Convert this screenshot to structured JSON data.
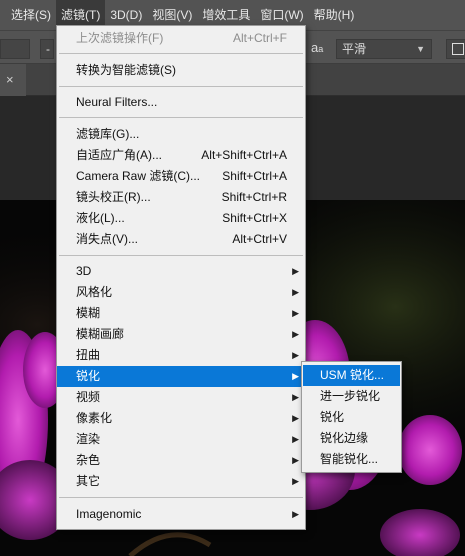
{
  "menubar": {
    "items": [
      {
        "label": "选择(S)"
      },
      {
        "label": "滤镜(T)"
      },
      {
        "label": "3D(D)"
      },
      {
        "label": "视图(V)"
      },
      {
        "label": "增效工具"
      },
      {
        "label": "窗口(W)"
      },
      {
        "label": "帮助(H)"
      }
    ]
  },
  "optbar": {
    "left_field": "",
    "left_dash": "-",
    "aa_big": "a",
    "aa_small": "a",
    "smooth_value": "平滑"
  },
  "tabs": {
    "close_glyph": "×"
  },
  "filter_menu": {
    "last_filter": {
      "label": "上次滤镜操作(F)",
      "shortcut": "Alt+Ctrl+F"
    },
    "convert_smart": {
      "label": "转换为智能滤镜(S)"
    },
    "neural": {
      "label": "Neural Filters..."
    },
    "gallery": {
      "label": "滤镜库(G)..."
    },
    "adaptive_wide": {
      "label": "自适应广角(A)...",
      "shortcut": "Alt+Shift+Ctrl+A"
    },
    "camera_raw": {
      "label": "Camera Raw 滤镜(C)...",
      "shortcut": "Shift+Ctrl+A"
    },
    "lens_correction": {
      "label": "镜头校正(R)...",
      "shortcut": "Shift+Ctrl+R"
    },
    "liquify": {
      "label": "液化(L)...",
      "shortcut": "Shift+Ctrl+X"
    },
    "vanishing_point": {
      "label": "消失点(V)...",
      "shortcut": "Alt+Ctrl+V"
    },
    "groups": [
      {
        "label": "3D"
      },
      {
        "label": "风格化"
      },
      {
        "label": "模糊"
      },
      {
        "label": "模糊画廊"
      },
      {
        "label": "扭曲"
      },
      {
        "label": "锐化"
      },
      {
        "label": "视频"
      },
      {
        "label": "像素化"
      },
      {
        "label": "渲染"
      },
      {
        "label": "杂色"
      },
      {
        "label": "其它"
      }
    ],
    "imagenomic": {
      "label": "Imagenomic"
    }
  },
  "sharpen_submenu": {
    "items": [
      {
        "label": "USM 锐化..."
      },
      {
        "label": "进一步锐化"
      },
      {
        "label": "锐化"
      },
      {
        "label": "锐化边缘"
      },
      {
        "label": "智能锐化..."
      }
    ]
  },
  "colors": {
    "highlight": "#0a78d7",
    "menu_bg": "#f0f0f0",
    "chrome": "#535353",
    "orchid": "#b01fb0"
  },
  "icons": {
    "submenu_arrow": "triangle-right-icon",
    "dropdown_chevron": "chevron-down-icon",
    "tab_close": "close-icon"
  }
}
